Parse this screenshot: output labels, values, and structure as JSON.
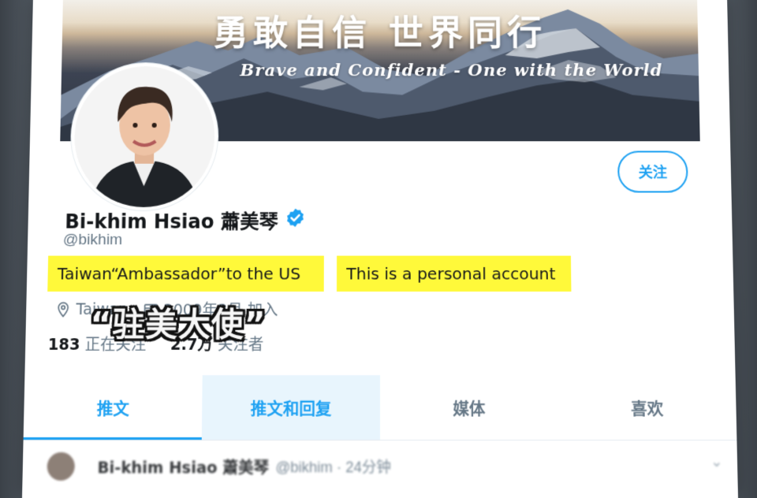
{
  "banner": {
    "title": "勇敢自信 世界同行",
    "subtitle": "Brave and Confident - One with the World"
  },
  "profile": {
    "name": "Bi-khim Hsiao 蕭美琴",
    "handle": "@bikhim",
    "follow_label": "关注",
    "bio_highlight_1": "Taiwan“Ambassador”to the US",
    "bio_highlight_2": "This is a personal account",
    "location": "Taiwan",
    "joined": "2009年3月 加入",
    "following_count": "183",
    "following_label": "正在关注",
    "followers_count": "2.7万",
    "followers_label": "关注者"
  },
  "caption": "“驻美大使”",
  "tabs": [
    {
      "label": "推文"
    },
    {
      "label": "推文和回复"
    },
    {
      "label": "媒体"
    },
    {
      "label": "喜欢"
    }
  ],
  "tweet": {
    "name": "Bi-khim Hsiao 蕭美琴",
    "handle": "@bikhim · 24分钟"
  },
  "colors": {
    "accent": "#1da1f2",
    "highlight": "#fff93a",
    "text": "#14171a",
    "secondary": "#657786"
  },
  "icons": [
    "location-icon",
    "calendar-icon",
    "verified-icon",
    "chevron-down-icon"
  ]
}
